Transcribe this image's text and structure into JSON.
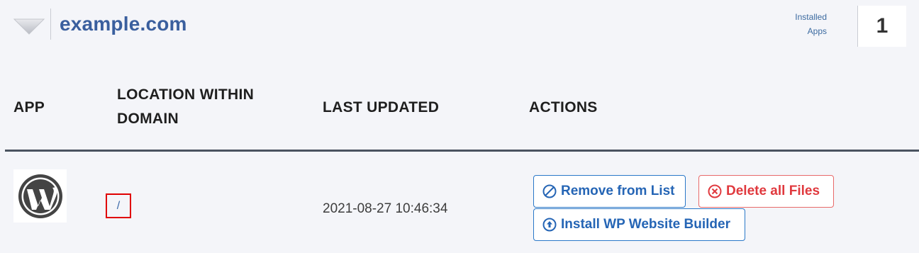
{
  "header": {
    "domain": "example.com",
    "installed_label_line1": "Installed",
    "installed_label_line2": "Apps",
    "installed_count": "1"
  },
  "table": {
    "columns": {
      "app": "APP",
      "location": "LOCATION WITHIN DOMAIN",
      "last_updated": "LAST UPDATED",
      "actions": "ACTIONS"
    },
    "rows": [
      {
        "app_icon": "wordpress-logo",
        "location": "/",
        "last_updated": "2021-08-27 10:46:34",
        "actions": {
          "remove": "Remove from List",
          "delete": "Delete all Files",
          "install": "Install WP Website Builder"
        }
      }
    ]
  },
  "colors": {
    "background": "#f4f5f9",
    "domain_title": "#3a5f9e",
    "primary_button": "#2565b5",
    "danger_button": "#e0393e",
    "highlight_box": "#e00000",
    "table_rule": "#4a5360"
  },
  "icons": {
    "collapse": "triangle-down-icon",
    "remove": "ban-icon",
    "delete": "circle-x-icon",
    "install": "circle-arrow-up-icon"
  }
}
